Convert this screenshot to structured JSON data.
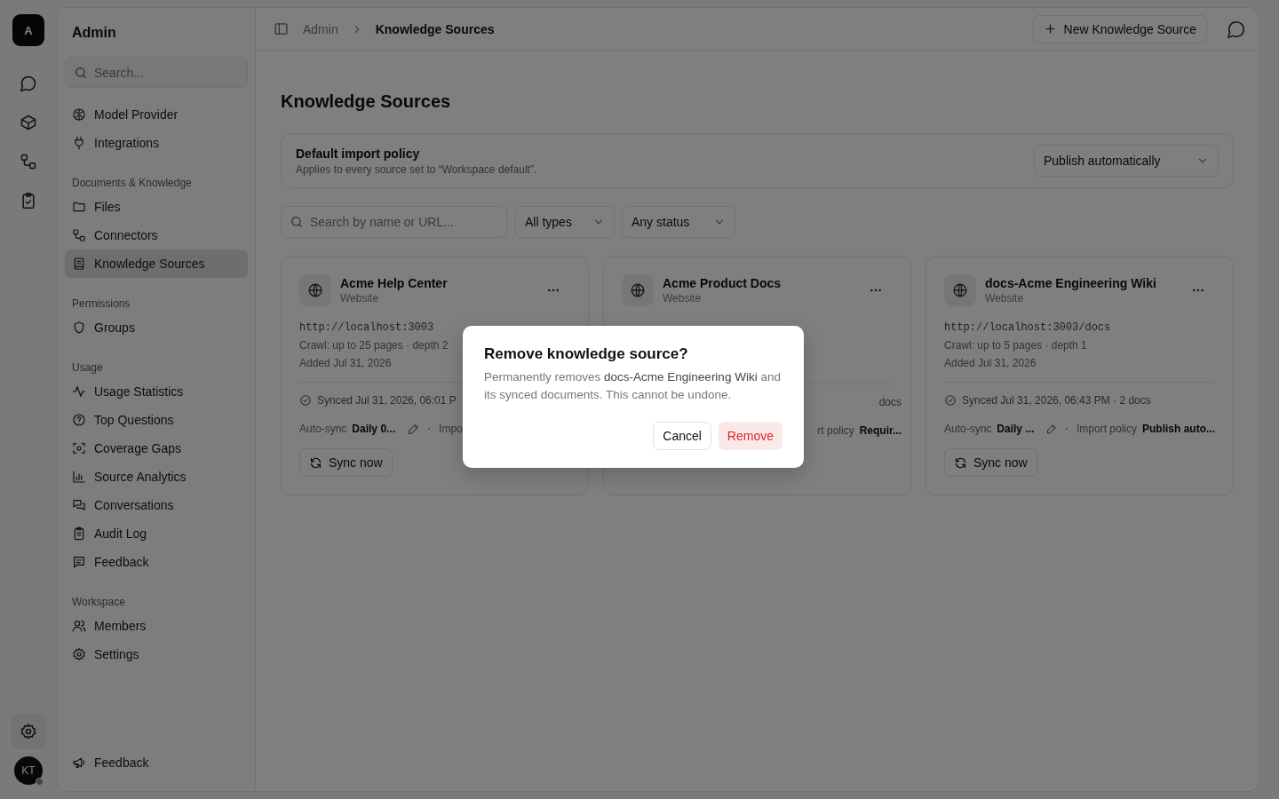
{
  "rail": {
    "logo": "A",
    "avatar": "KT"
  },
  "sidebar": {
    "title": "Admin",
    "search": {
      "placeholder": "Search..."
    },
    "groups": [
      {
        "items": [
          {
            "label": "Model Provider",
            "selected": false
          },
          {
            "label": "Integrations",
            "selected": false
          }
        ]
      },
      {
        "heading": "Documents & Knowledge",
        "items": [
          {
            "label": "Files",
            "selected": false
          },
          {
            "label": "Connectors",
            "selected": false
          },
          {
            "label": "Knowledge Sources",
            "selected": true
          }
        ]
      },
      {
        "heading": "Permissions",
        "items": [
          {
            "label": "Groups",
            "selected": false
          }
        ]
      },
      {
        "heading": "Usage",
        "items": [
          {
            "label": "Usage Statistics",
            "selected": false
          },
          {
            "label": "Top Questions",
            "selected": false
          },
          {
            "label": "Coverage Gaps",
            "selected": false
          },
          {
            "label": "Source Analytics",
            "selected": false
          },
          {
            "label": "Conversations",
            "selected": false
          },
          {
            "label": "Audit Log",
            "selected": false
          },
          {
            "label": "Feedback",
            "selected": false
          }
        ]
      },
      {
        "heading": "Workspace",
        "items": [
          {
            "label": "Members",
            "selected": false
          },
          {
            "label": "Settings",
            "selected": false
          }
        ]
      }
    ],
    "footer": "Feedback"
  },
  "breadcrumb": [
    "Admin",
    "Knowledge Sources"
  ],
  "new_button": "New Knowledge Source",
  "page_title": "Knowledge Sources",
  "policy": {
    "title": "Default import policy",
    "subtitle": "Applies to every source set to “Workspace default”.",
    "value": "Publish automatically"
  },
  "filters": {
    "search": {
      "placeholder": "Search by name or URL..."
    },
    "type": "All types",
    "status": "Any status"
  },
  "cards": [
    {
      "name": "Acme Help Center",
      "type": "Website",
      "url": "http://localhost:3003",
      "crawl": "Crawl: up to 25 pages · depth 2",
      "added": "Added Jul 31, 2026",
      "synced": "Synced Jul 31, 2026, 06:01 P",
      "partial": false,
      "auto_label": "Auto-sync",
      "auto_value": "Daily 0...",
      "policy_label": "Impo",
      "sync_button": "Sync now"
    },
    {
      "name": "Acme Product Docs",
      "type": "Website",
      "synced": "docs",
      "partial": true,
      "policy_label": "rt policy",
      "policy_value": "Requir..."
    },
    {
      "name": "docs-Acme Engineering Wiki",
      "type": "Website",
      "url": "http://localhost:3003/docs",
      "crawl": "Crawl: up to 5 pages · depth 1",
      "added": "Added Jul 31, 2026",
      "synced": "Synced Jul 31, 2026, 06:43 PM · 2 docs",
      "partial": false,
      "auto_label": "Auto-sync",
      "auto_value": "Daily ...",
      "policy_label": "Import policy",
      "policy_value": "Publish auto...",
      "sync_button": "Sync now"
    }
  ],
  "dialog": {
    "title": "Remove knowledge source?",
    "body": "Permanently removes **docs-Acme Engineering Wiki** and its synced documents. This cannot be undone.",
    "cancel": "Cancel",
    "confirm": "Remove"
  }
}
